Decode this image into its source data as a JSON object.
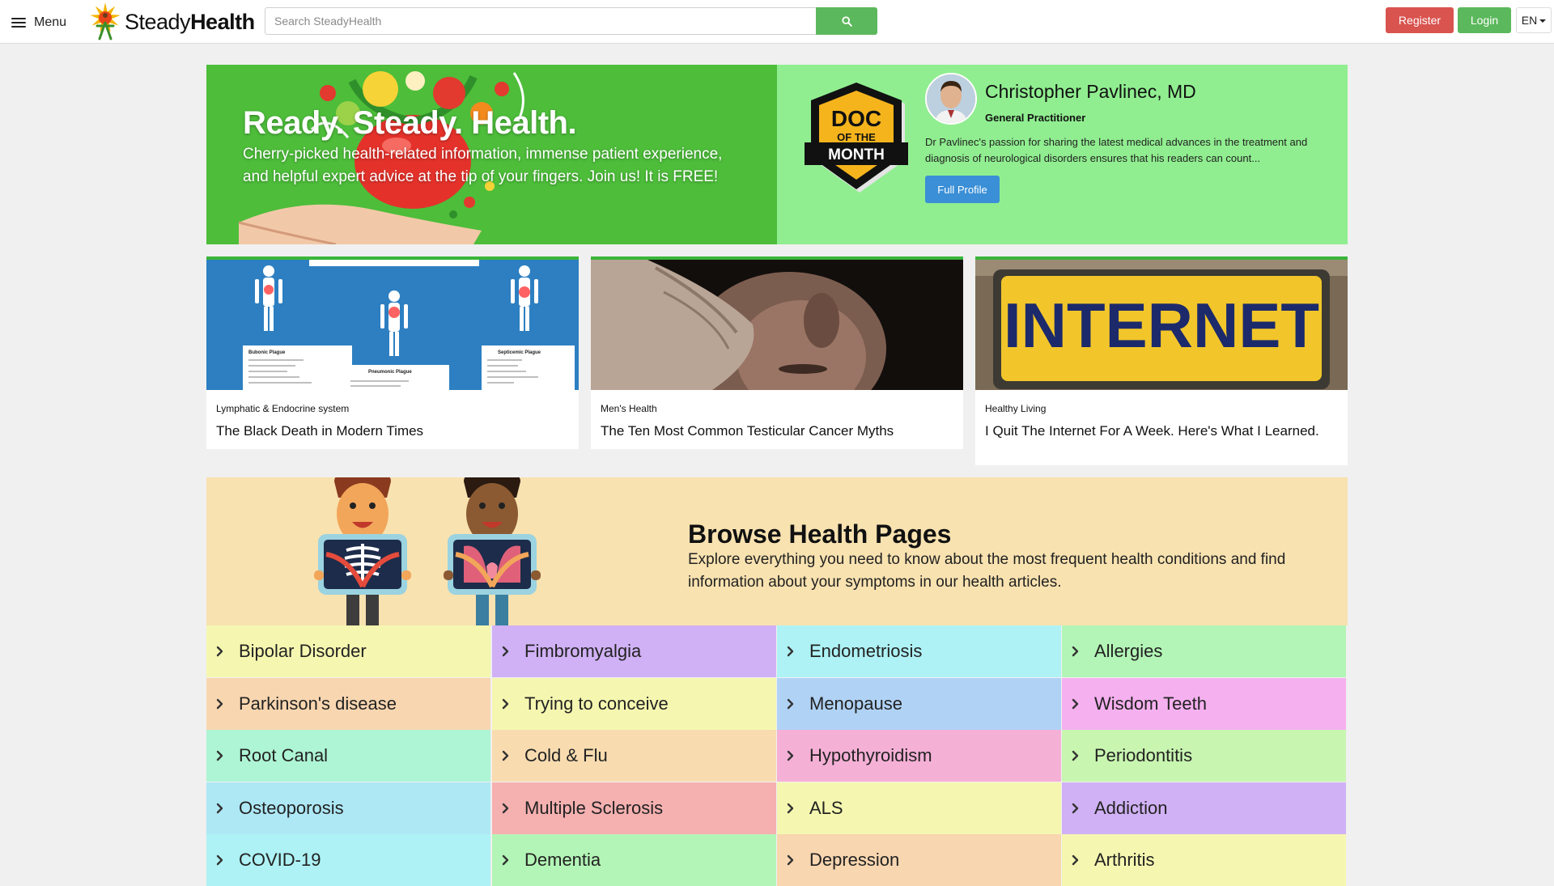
{
  "header": {
    "menu_label": "Menu",
    "logo_text_light": "Steady",
    "logo_text_bold": "Health",
    "search_placeholder": "Search SteadyHealth",
    "register_label": "Register",
    "login_label": "Login",
    "language": "EN"
  },
  "hero": {
    "title": "Ready. Steady. Health.",
    "text": "Cherry-picked health-related information, immense patient experience, and helpful expert advice at the tip of your fingers. Join us! It is FREE!"
  },
  "doctor_of_month": {
    "badge_line1": "DOC",
    "badge_line2": "OF THE",
    "badge_line3": "MONTH",
    "name": "Christopher Pavlinec, MD",
    "role": "General Practitioner",
    "description": "Dr Pavlinec's passion for sharing the latest medical advances in the treatment and diagnosis of neurological disorders ensures that his readers can count...",
    "button_label": "Full Profile"
  },
  "articles": [
    {
      "category": "Lymphatic & Endocrine system",
      "title": "The Black Death in Modern Times",
      "image_labels": [
        "Bubonic Plague",
        "Pneumonic Plague",
        "Septicemic Plague"
      ]
    },
    {
      "category": "Men's Health",
      "title": "The Ten Most Common Testicular Cancer Myths"
    },
    {
      "category": "Healthy Living",
      "title": "I Quit The Internet For A Week. Here's What I Learned.",
      "image_sign_text": "INTERNET"
    }
  ],
  "browse": {
    "title": "Browse Health Pages",
    "text": "Explore everything you need to know about the most frequent health conditions and find information about your symptoms in our health articles."
  },
  "topics": [
    {
      "label": "Bipolar Disorder",
      "color": "#f5f7b0"
    },
    {
      "label": "Fimbromyalgia",
      "color": "#d0b1f5"
    },
    {
      "label": "Endometriosis",
      "color": "#aef2f5"
    },
    {
      "label": "Allergies",
      "color": "#b3f5b6"
    },
    {
      "label": "Parkinson's disease",
      "color": "#f8d6b0"
    },
    {
      "label": "Trying to conceive",
      "color": "#f5f7b0"
    },
    {
      "label": "Menopause",
      "color": "#b0d2f5"
    },
    {
      "label": "Wisdom Teeth",
      "color": "#f5b0ef"
    },
    {
      "label": "Root Canal",
      "color": "#aef5d5"
    },
    {
      "label": "Cold & Flu",
      "color": "#f8dcb0"
    },
    {
      "label": "Hypothyroidism",
      "color": "#f5b0d6"
    },
    {
      "label": "Periodontitis",
      "color": "#c8f5b0"
    },
    {
      "label": "Osteoporosis",
      "color": "#aee8f5"
    },
    {
      "label": "Multiple Sclerosis",
      "color": "#f5b0b0"
    },
    {
      "label": "ALS",
      "color": "#f5f7b0"
    },
    {
      "label": "Addiction",
      "color": "#d0b1f5"
    },
    {
      "label": "COVID-19",
      "color": "#aef2f5"
    },
    {
      "label": "Dementia",
      "color": "#b3f5b6"
    },
    {
      "label": "Depression",
      "color": "#f8d6b0"
    },
    {
      "label": "Arthritis",
      "color": "#f5f7b0"
    }
  ],
  "colors": {
    "hero_green": "#4dbd3a",
    "doc_green": "#90ee90",
    "browse_bg": "#f8e2b0",
    "register_red": "#d9534f",
    "login_green": "#5cb85c",
    "profile_blue": "#3a8fd6"
  },
  "icons": {
    "menu": "hamburger-icon",
    "search": "search-icon",
    "language_caret": "caret-down-icon",
    "topic_chevron": "chevron-right-icon"
  }
}
